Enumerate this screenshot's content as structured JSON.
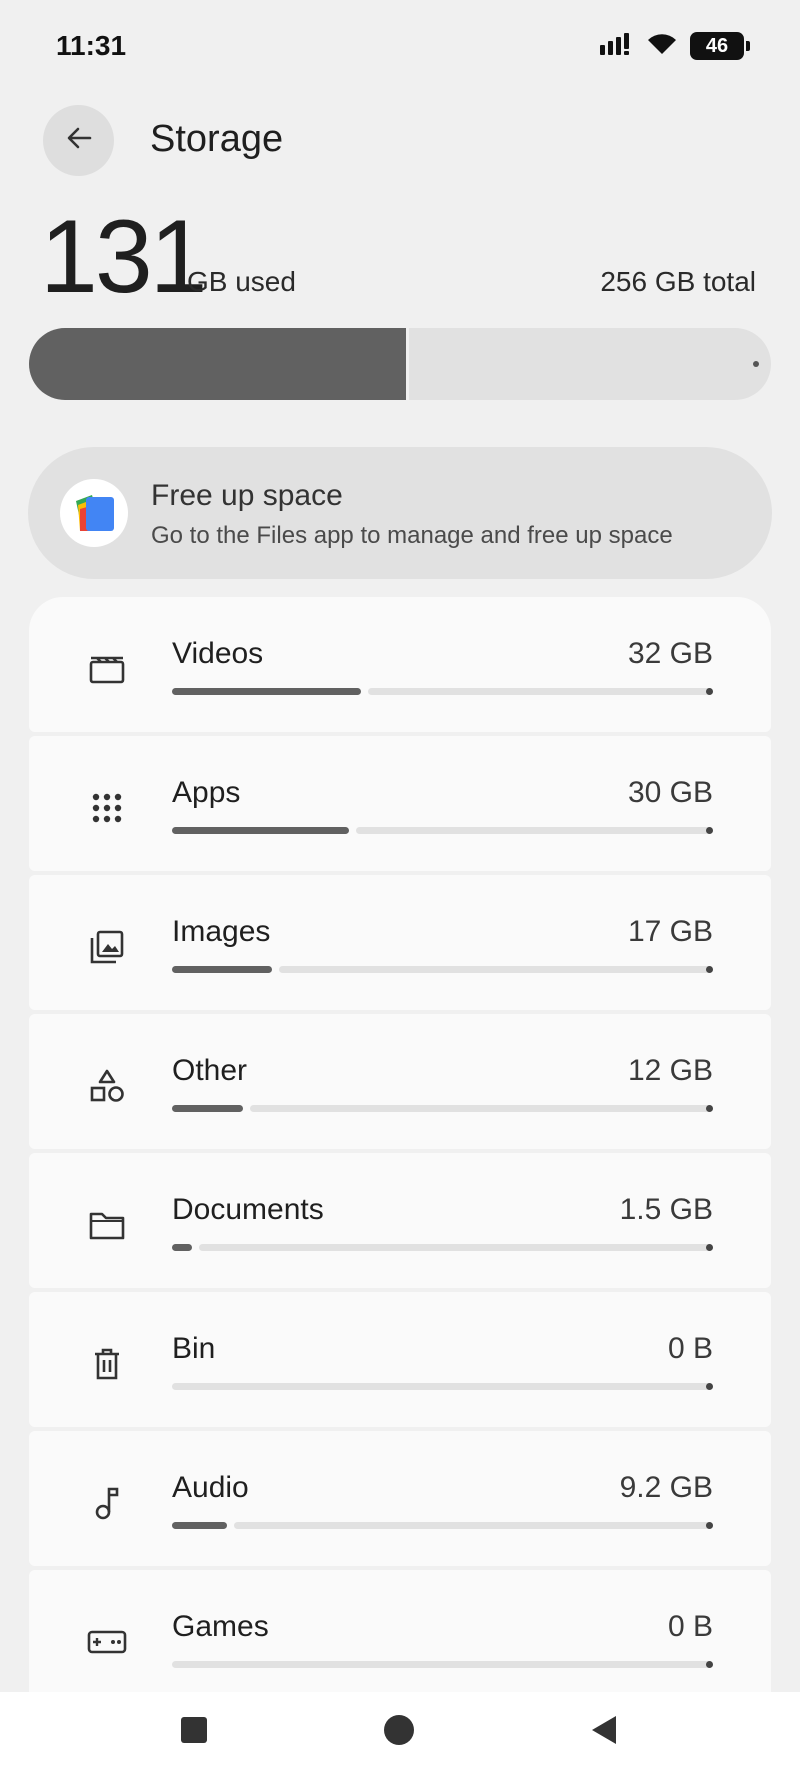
{
  "status_bar": {
    "time": "11:31",
    "battery": "46",
    "icons": [
      "signal-icon",
      "wifi-icon",
      "battery-icon"
    ]
  },
  "header": {
    "title": "Storage",
    "back_icon": "arrow-back-icon"
  },
  "usage": {
    "used_value": "131",
    "used_label": "GB used",
    "total_label": "256 GB total",
    "used_fraction": 0.512
  },
  "free_up": {
    "title": "Free up space",
    "subtitle": "Go to the Files app to manage and free up space",
    "icon": "files-app-icon"
  },
  "categories": [
    {
      "key": "videos",
      "name": "Videos",
      "size": "32 GB",
      "icon": "video-clapper-icon",
      "fraction": 0.125
    },
    {
      "key": "apps",
      "name": "Apps",
      "size": "30 GB",
      "icon": "apps-grid-icon",
      "fraction": 0.117
    },
    {
      "key": "images",
      "name": "Images",
      "size": "17 GB",
      "icon": "image-gallery-icon",
      "fraction": 0.066
    },
    {
      "key": "other",
      "name": "Other",
      "size": "12 GB",
      "icon": "shapes-icon",
      "fraction": 0.047
    },
    {
      "key": "documents",
      "name": "Documents",
      "size": "1.5 GB",
      "icon": "folder-icon",
      "fraction": 0.006
    },
    {
      "key": "bin",
      "name": "Bin",
      "size": "0 B",
      "icon": "trash-icon",
      "fraction": 0
    },
    {
      "key": "audio",
      "name": "Audio",
      "size": "9.2 GB",
      "icon": "music-note-icon",
      "fraction": 0.036
    },
    {
      "key": "games",
      "name": "Games",
      "size": "0 B",
      "icon": "gamepad-icon",
      "fraction": 0
    }
  ],
  "nav_bar": {
    "icons": [
      "recents-square-icon",
      "home-circle-icon",
      "back-triangle-icon"
    ]
  },
  "colors": {
    "background": "#f0f0f0",
    "bar_fill": "#616161",
    "bar_track": "#e1e1e1",
    "card": "#fafafa"
  }
}
